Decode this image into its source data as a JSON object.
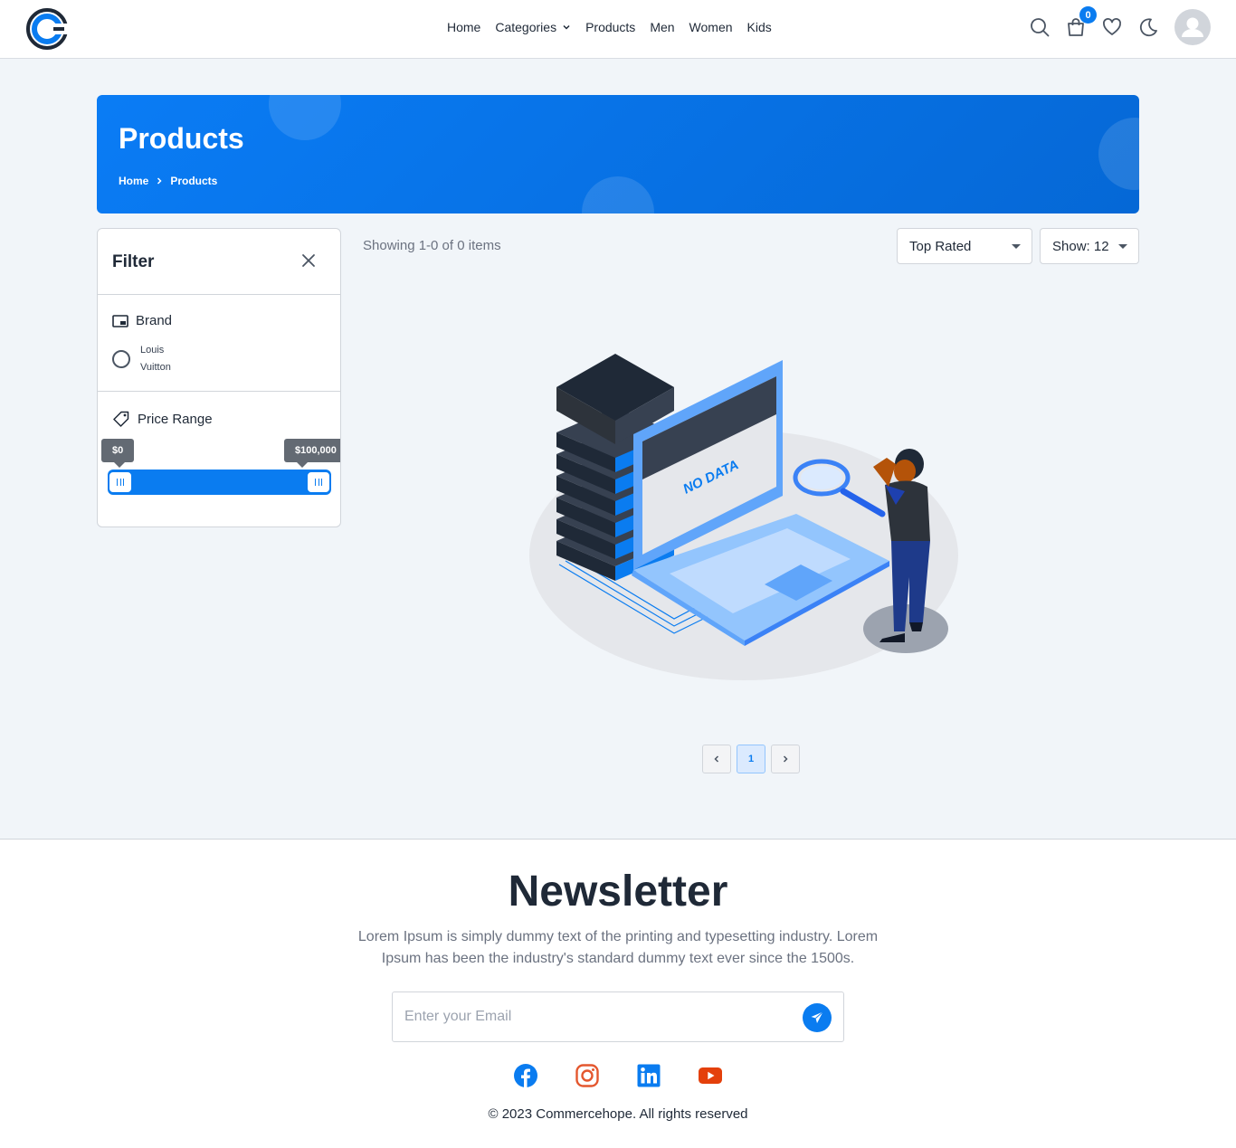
{
  "header": {
    "nav": [
      "Home",
      "Categories",
      "Products",
      "Men",
      "Women",
      "Kids"
    ],
    "cart_count": "0",
    "icons": [
      "search-icon",
      "cart-icon",
      "heart-icon",
      "moon-icon",
      "user-icon"
    ]
  },
  "banner": {
    "title": "Products",
    "breadcrumb": [
      "Home",
      "Products"
    ]
  },
  "filter": {
    "title": "Filter",
    "brand": {
      "title": "Brand",
      "options": [
        "Louis Vuitton"
      ]
    },
    "price": {
      "title": "Price Range",
      "min_label": "$0",
      "max_label": "$100,000"
    }
  },
  "listing": {
    "showing": "Showing 1-0 of 0 items",
    "sort": "Top Rated",
    "show": "Show: 12",
    "empty_art_text": "NO DATA"
  },
  "pagination": {
    "current": "1"
  },
  "footer": {
    "title": "Newsletter",
    "text": "Lorem Ipsum is simply dummy text of the printing and typesetting industry. Lorem Ipsum has been the industry's standard dummy text ever since the 1500s.",
    "email_placeholder": "Enter your Email",
    "socials": [
      "facebook-icon",
      "instagram-icon",
      "linkedin-icon",
      "youtube-icon"
    ],
    "copyright": "© 2023 Commercehope. All rights reserved"
  },
  "colors": {
    "accent": "#0a7cf0",
    "page_bg": "#f1f5f9",
    "instagram": "#e4572e",
    "youtube": "#e4400b"
  }
}
